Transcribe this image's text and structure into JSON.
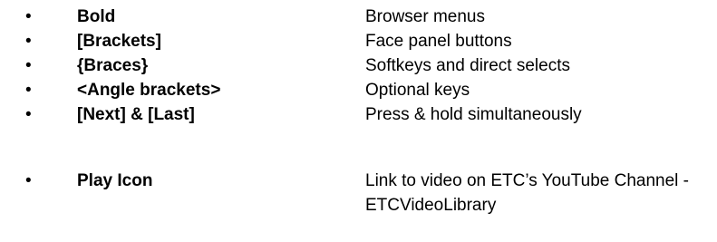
{
  "legend": {
    "bullet_glyph": "•",
    "items": [
      {
        "term": "Bold",
        "description": "Browser menus"
      },
      {
        "term": "[Brackets]",
        "description": "Face panel buttons"
      },
      {
        "term": "{Braces}",
        "description": "Softkeys and direct selects"
      },
      {
        "term": "<Angle brackets>",
        "description": "Optional keys"
      },
      {
        "term": "[Next] & [Last]",
        "description": "Press & hold simultaneously"
      },
      {
        "term": "Play Icon",
        "description": "Link to video on ETC’s YouTube Channel - ETCVideoLibrary"
      }
    ]
  }
}
